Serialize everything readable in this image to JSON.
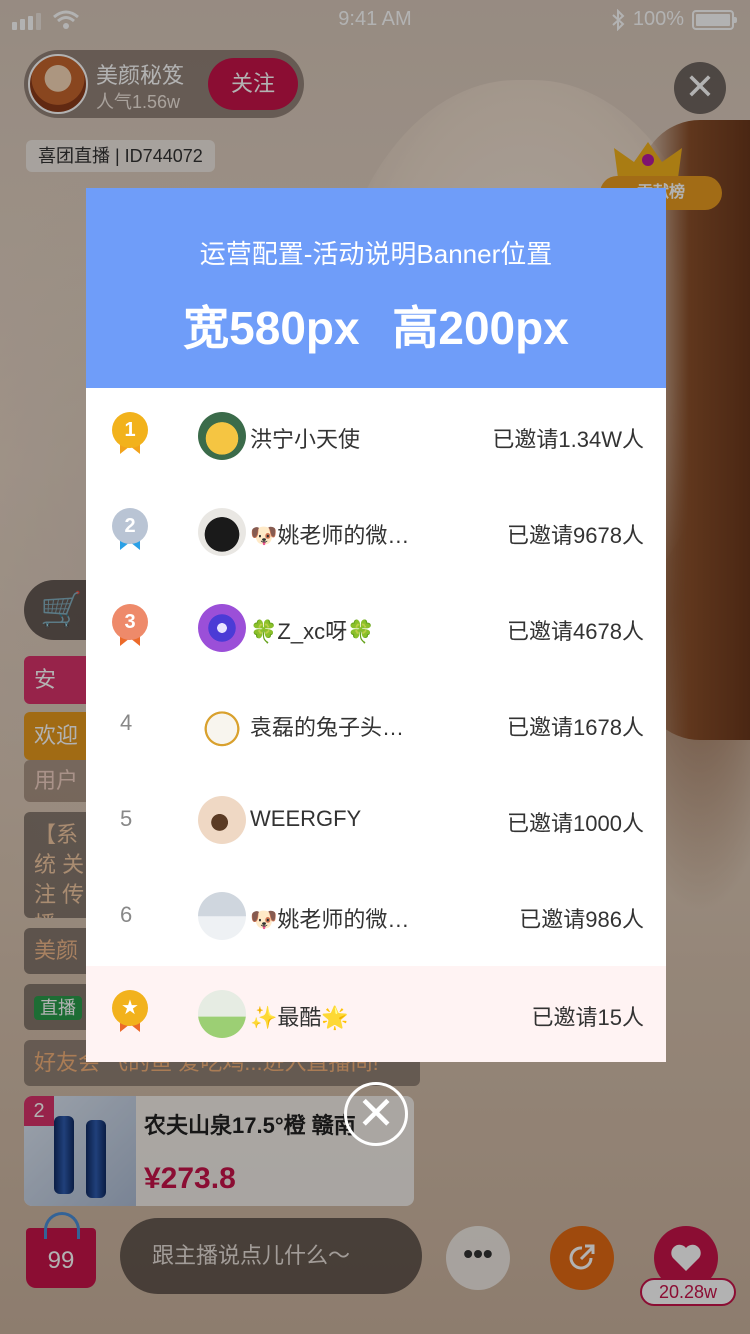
{
  "status_bar": {
    "time": "9:41 AM",
    "battery": "100%"
  },
  "anchor": {
    "name": "美颜秘笈",
    "popularity": "人气1.56w",
    "follow_label": "关注",
    "room_id": "喜团直播 | ID744072"
  },
  "top_close": "✕",
  "rank_tag": "贡献榜",
  "chat": {
    "messages": [
      "安",
      "欢迎",
      "用户",
      "【系统 关注 传播",
      "美颜秘",
      "直播",
      "好友会 飞的鱼 爱吃鸡...进入直播间!"
    ]
  },
  "product": {
    "rank": "2",
    "name": "农夫山泉17.5°橙 赣南",
    "price": "¥273.8"
  },
  "bottom_bar": {
    "bag_count": "99",
    "input_placeholder": "跟主播说点儿什么～",
    "more": "•••",
    "like_count": "20.28w"
  },
  "modal": {
    "banner_title": "运营配置-活动说明Banner位置",
    "banner_size": "宽580px 高200px",
    "rows": [
      {
        "rank": "1",
        "name": "洪宁小天使",
        "invited": "已邀请1.34W人"
      },
      {
        "rank": "2",
        "name": "🐶姚老师的微…",
        "invited": "已邀请9678人"
      },
      {
        "rank": "3",
        "name": "🍀Z_xc呀🍀",
        "invited": "已邀请4678人"
      },
      {
        "rank": "4",
        "name": "袁磊的兔子头…",
        "invited": "已邀请1678人"
      },
      {
        "rank": "5",
        "name": "WEERGFY",
        "invited": "已邀请1000人"
      },
      {
        "rank": "6",
        "name": "🐶姚老师的微…",
        "invited": "已邀请986人"
      },
      {
        "rank": "★",
        "name": "✨最酷🌟",
        "invited": "已邀请15人"
      }
    ],
    "close": "✕"
  },
  "colors": {
    "accent": "#c8144a",
    "banner": "#6f9df9",
    "gold": "#f2b21c",
    "silver": "#b9c4d4",
    "bronze": "#ee8a6a"
  }
}
